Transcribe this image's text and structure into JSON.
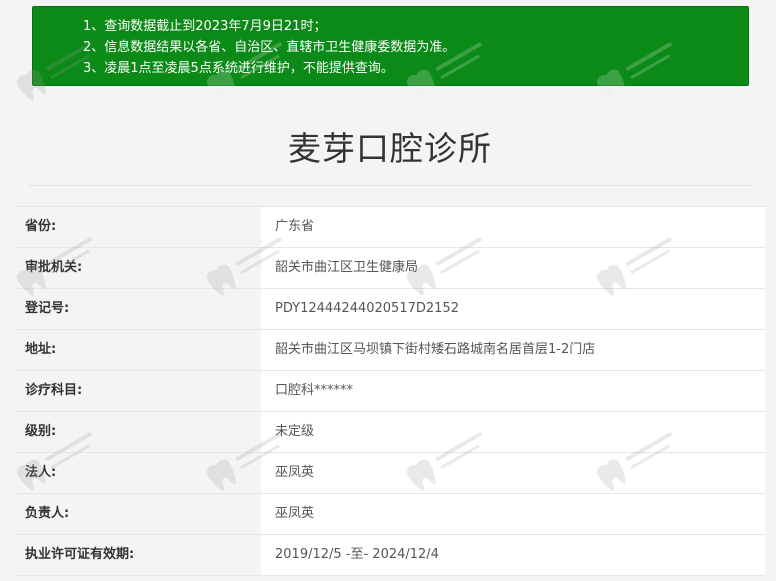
{
  "notice": {
    "lines": [
      "1、查询数据截止到2023年7月9日21时；",
      "2、信息数据结果以各省、自治区、直辖市卫生健康委数据为准。",
      "3、凌晨1点至凌晨5点系统进行维护，不能提供查询。"
    ]
  },
  "clinic": {
    "name": "麦芽口腔诊所"
  },
  "fields": [
    {
      "label": "省份:",
      "value": "广东省"
    },
    {
      "label": "审批机关:",
      "value": "韶关市曲江区卫生健康局"
    },
    {
      "label": "登记号:",
      "value": "PDY12444244020517D2152"
    },
    {
      "label": "地址:",
      "value": "韶关市曲江区马坝镇下街村矮石路城南名居首层1-2门店"
    },
    {
      "label": "诊疗科目:",
      "value": "口腔科******"
    },
    {
      "label": "级别:",
      "value": "未定级"
    },
    {
      "label": "法人:",
      "value": "巫凤英"
    },
    {
      "label": "负责人:",
      "value": "巫凤英"
    },
    {
      "label": "执业许可证有效期:",
      "value": "2019/12/5 -至- 2024/12/4"
    }
  ],
  "colors": {
    "notice_bg": "#0b8a17",
    "page_bg": "#f4f4f4",
    "value_bg": "#ffffff"
  },
  "watermark": {
    "icon": "tooth-logo-icon"
  }
}
